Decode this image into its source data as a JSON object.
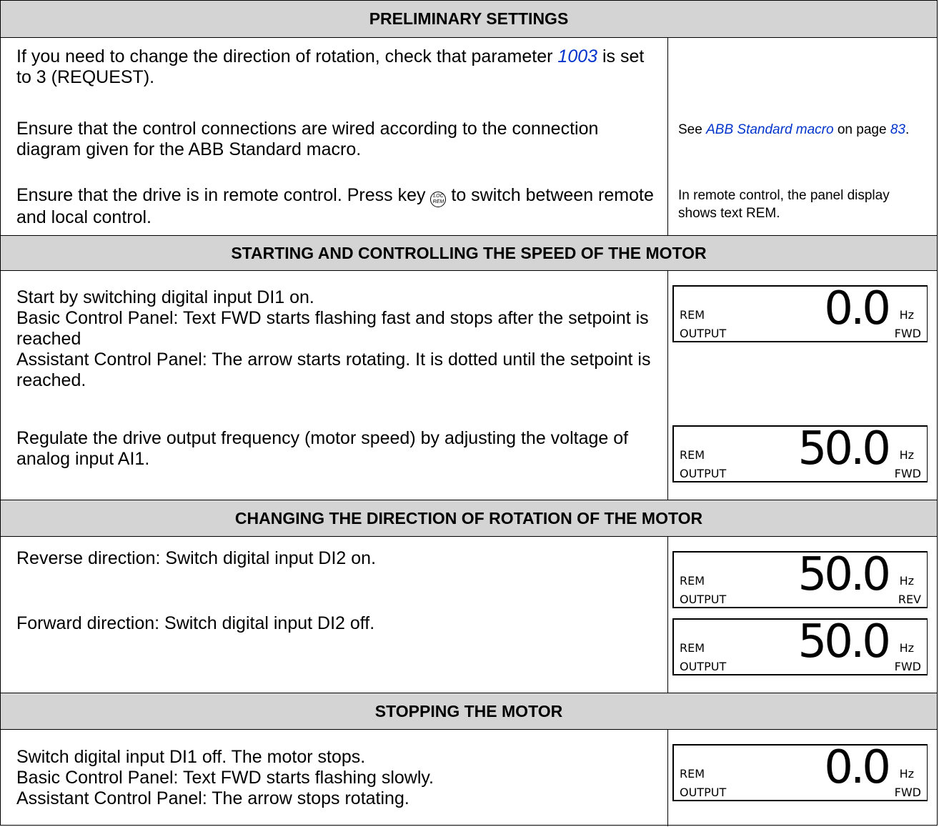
{
  "headers": {
    "preliminary": "PRELIMINARY SETTINGS",
    "starting": "STARTING AND CONTROLLING THE SPEED OF THE MOTOR",
    "direction": "CHANGING THE DIRECTION OF ROTATION OF THE MOTOR",
    "stopping": "STOPPING THE MOTOR"
  },
  "preliminary": {
    "rotation_pre": "If you need to change the direction of rotation, check that parameter",
    "rotation_param": "1003",
    "rotation_post": "is set to 3 (REQUEST).",
    "wiring": "Ensure that the control connections are wired according to the connection diagram given for the ABB Standard macro.",
    "wiring_note_pre": "See",
    "wiring_note_link": "ABB Standard macro",
    "wiring_note_mid": "on page",
    "wiring_note_page": "83",
    "wiring_note_end": ".",
    "remote_pre": "Ensure that the drive is in remote control. Press key",
    "remote_key_top": "LOC",
    "remote_key_bottom": "REM",
    "remote_post": "to switch between remote and local control.",
    "remote_note": "In remote control, the panel display shows text REM."
  },
  "starting": {
    "line1": "Start by switching digital input DI1 on.",
    "line2": "Basic Control Panel: Text FWD starts flashing fast and stops after the setpoint is reached",
    "line3": "Assistant Control Panel: The arrow starts rotating. It is dotted until the setpoint is reached.",
    "regulate": "Regulate the drive output frequency (motor speed) by adjusting the voltage of analog input AI1."
  },
  "direction": {
    "reverse": "Reverse direction: Switch digital input DI2 on.",
    "forward": "Forward direction: Switch digital input DI2 off."
  },
  "stopping": {
    "line1": "Switch digital input DI1 off. The motor stops.",
    "line2": "Basic Control Panel: Text FWD starts flashing slowly.",
    "line3": "Assistant Control Panel: The arrow stops rotating."
  },
  "panels": [
    {
      "mode": "REM",
      "value": "0.0",
      "unit": "Hz",
      "output": "OUTPUT",
      "dir": "FWD"
    },
    {
      "mode": "REM",
      "value": "50.0",
      "unit": "Hz",
      "output": "OUTPUT",
      "dir": "FWD"
    },
    {
      "mode": "REM",
      "value": "50.0",
      "unit": "Hz",
      "output": "OUTPUT",
      "dir": "REV"
    },
    {
      "mode": "REM",
      "value": "50.0",
      "unit": "Hz",
      "output": "OUTPUT",
      "dir": "FWD"
    },
    {
      "mode": "REM",
      "value": "0.0",
      "unit": "Hz",
      "output": "OUTPUT",
      "dir": "FWD"
    }
  ]
}
